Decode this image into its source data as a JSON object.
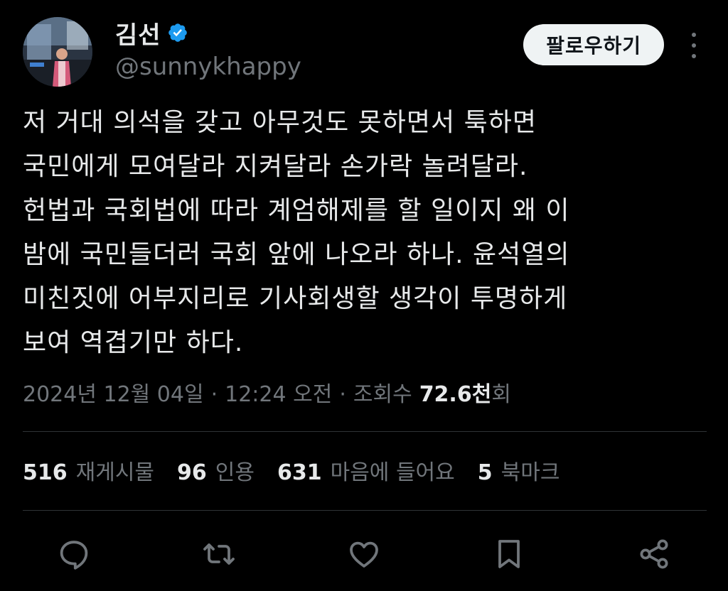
{
  "author": {
    "display_name": "김선",
    "handle": "@sunnykhappy",
    "verified_icon": "verified-badge-icon",
    "verified_color": "#1d9bf0"
  },
  "header": {
    "follow_label": "팔로우하기",
    "more_icon": "more-options-icon"
  },
  "tweet": {
    "text": "저 거대 의석을 갖고 아무것도 못하면서 툭하면\n국민에게 모여달라 지켜달라 손가락 놀려달라.\n헌법과 국회법에 따라 계엄해제를 할 일이지 왜 이\n밤에 국민들더러 국회 앞에 나오라 하나. 윤석열의\n미친짓에 어부지리로 기사회생할 생각이 투명하게\n보여 역겹기만 하다."
  },
  "meta": {
    "date": "2024년 12월 04일",
    "separator1": "·",
    "time": "12:24 오전",
    "separator2": "·",
    "views_label": "조회수",
    "views_number": "72.6천",
    "views_suffix": "회"
  },
  "stats": [
    {
      "number": "516",
      "label": "재게시물"
    },
    {
      "number": "96",
      "label": "인용"
    },
    {
      "number": "631",
      "label": "마음에 들어요"
    },
    {
      "number": "5",
      "label": "북마크"
    }
  ],
  "actions": [
    {
      "icon": "reply-icon"
    },
    {
      "icon": "repost-icon"
    },
    {
      "icon": "like-icon"
    },
    {
      "icon": "bookmark-icon"
    },
    {
      "icon": "share-icon"
    }
  ],
  "colors": {
    "background": "#000000",
    "text_primary": "#e7e9ea",
    "text_secondary": "#71767b",
    "divider": "#2f3336",
    "follow_bg": "#eff3f4",
    "icon": "#71767b"
  }
}
